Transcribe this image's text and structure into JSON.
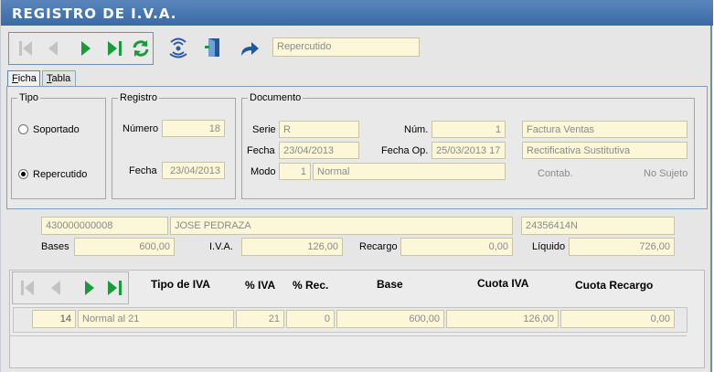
{
  "window": {
    "title": "REGISTRO DE I.V.A."
  },
  "toolbar": {
    "type_field": "Repercutido"
  },
  "tabs": [
    {
      "label_underlined": "F",
      "label_rest": "icha"
    },
    {
      "label_underlined": "T",
      "label_rest": "abla"
    }
  ],
  "tipo": {
    "title": "Tipo",
    "options": [
      {
        "label": "Soportado",
        "checked": false
      },
      {
        "label": "Repercutido",
        "checked": true
      }
    ]
  },
  "registro": {
    "title": "Registro",
    "numero_label": "Número",
    "numero": "18",
    "fecha_label": "Fecha",
    "fecha": "23/04/2013"
  },
  "documento": {
    "title": "Documento",
    "serie_label": "Serie",
    "serie": "R",
    "num_label": "Núm.",
    "num": "1",
    "fecha_label": "Fecha",
    "fecha": "23/04/2013",
    "fecha_op_label": "Fecha Op.",
    "fecha_op": "25/03/2013 17",
    "modo_label": "Modo",
    "modo_code": "1",
    "modo_name": "Normal",
    "tipo_doc": "Factura Ventas",
    "rectificativa": "Rectificativa Sustitutiva",
    "contab_label": "Contab.",
    "no_sujeto_label": "No Sujeto"
  },
  "cliente": {
    "cuenta": "430000000008",
    "nombre": "JOSE PEDRAZA",
    "nif": "24356414N"
  },
  "totales": {
    "bases_label": "Bases",
    "bases": "600,00",
    "iva_label": "I.V.A.",
    "iva": "126,00",
    "recargo_label": "Recargo",
    "recargo": "0,00",
    "liquido_label": "Líquido",
    "liquido": "726,00"
  },
  "grid": {
    "headers": {
      "tipo_iva": "Tipo de IVA",
      "pct_iva": "% IVA",
      "pct_rec": "% Rec.",
      "base": "Base",
      "cuota_iva": "Cuota IVA",
      "cuota_recargo": "Cuota Recargo"
    },
    "rows": [
      {
        "code": "14",
        "tipo": "Normal al 21",
        "pct_iva": "21",
        "pct_rec": "0",
        "base": "600,00",
        "cuota_iva": "126,00",
        "cuota_recargo": "0,00"
      }
    ]
  },
  "colors": {
    "title_bar": "#4676b0",
    "field_bg": "#fbf7d8",
    "nav_green": "#1a9a3a"
  }
}
